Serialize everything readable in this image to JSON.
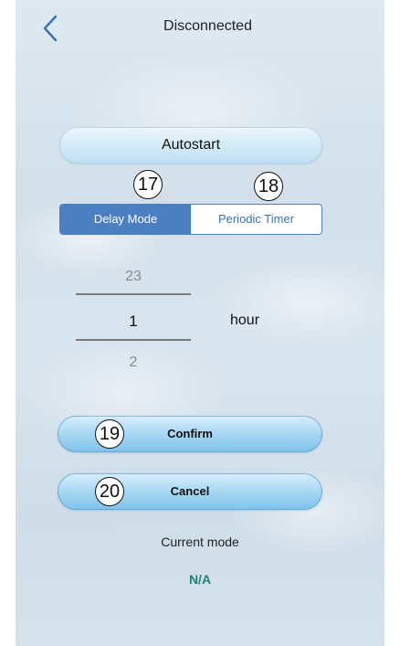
{
  "header": {
    "title": "Disconnected",
    "back_icon": "chevron-left-icon"
  },
  "autostart": {
    "label": "Autostart"
  },
  "annotations": {
    "b17": "17",
    "b18": "18",
    "b19": "19",
    "b20": "20"
  },
  "mode_toggle": {
    "options": [
      {
        "label": "Delay Mode",
        "selected": true
      },
      {
        "label": "Periodic Timer",
        "selected": false
      }
    ]
  },
  "picker": {
    "prev": "23",
    "current": "1",
    "next": "2",
    "unit": "hour"
  },
  "actions": {
    "confirm": "Confirm",
    "cancel": "Cancel"
  },
  "status": {
    "label": "Current mode",
    "value": "N/A"
  },
  "colors": {
    "accent": "#4a7fc1",
    "status_value": "#1f7f7a"
  }
}
